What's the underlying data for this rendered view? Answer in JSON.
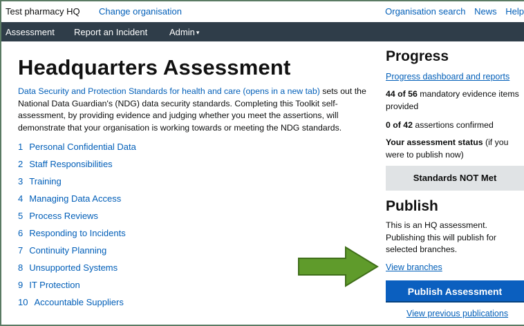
{
  "topbar": {
    "org_name": "Test pharmacy HQ",
    "change_org": "Change organisation",
    "links": [
      "Organisation search",
      "News",
      "Help"
    ]
  },
  "nav": {
    "items": [
      "Assessment",
      "Report an Incident",
      "Admin"
    ]
  },
  "main": {
    "title": "Headquarters Assessment",
    "intro_link": "Data Security and Protection Standards for health and care (opens in a new tab)",
    "intro_text": " sets out the National Data Guardian's (NDG) data security standards. Completing this Toolkit self-assessment, by providing evidence and judging whether you meet the assertions, will demonstrate that your organisation is working towards or meeting the NDG standards.",
    "sections": [
      {
        "num": "1",
        "label": "Personal Confidential Data"
      },
      {
        "num": "2",
        "label": "Staff Responsibilities"
      },
      {
        "num": "3",
        "label": "Training"
      },
      {
        "num": "4",
        "label": "Managing Data Access"
      },
      {
        "num": "5",
        "label": "Process Reviews"
      },
      {
        "num": "6",
        "label": "Responding to Incidents"
      },
      {
        "num": "7",
        "label": "Continuity Planning"
      },
      {
        "num": "8",
        "label": "Unsupported Systems"
      },
      {
        "num": "9",
        "label": "IT Protection"
      },
      {
        "num": "10",
        "label": "Accountable Suppliers"
      }
    ]
  },
  "progress": {
    "heading": "Progress",
    "dashboard_link": "Progress dashboard and reports",
    "evidence_count": "44 of 56",
    "evidence_text": " mandatory evidence items provided",
    "assertions_count": "0 of 42",
    "assertions_text": " assertions confirmed",
    "status_label": "Your assessment status",
    "status_suffix": " (if you were to publish now)",
    "status_value": "Standards NOT Met"
  },
  "publish": {
    "heading": "Publish",
    "description": "This is an HQ assessment. Publishing this will publish for selected branches.",
    "branches_link": "View branches",
    "button_label": "Publish Assessment",
    "previous_link": "View previous publications"
  },
  "colors": {
    "link": "#005eb8",
    "navbar": "#2f3d49",
    "publish_button": "#0b5fbf",
    "status_box": "#e0e3e5",
    "arrow": "#5f9b2b"
  },
  "icons": [
    "chevron-down-icon",
    "green-arrow-pointer"
  ]
}
